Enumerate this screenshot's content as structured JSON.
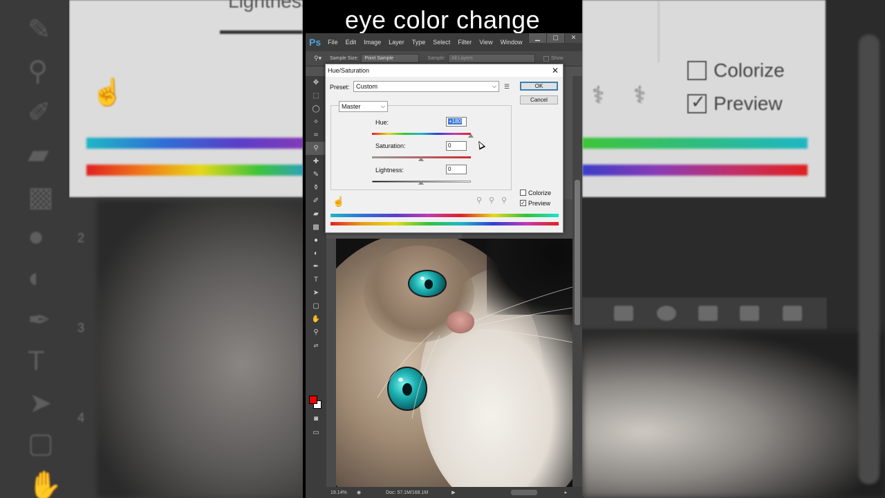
{
  "caption": "eye color change",
  "app": {
    "logo": "Ps",
    "menu": [
      "File",
      "Edit",
      "Image",
      "Layer",
      "Type",
      "Select",
      "Filter",
      "View",
      "Window"
    ],
    "window_controls": [
      "minimize-icon",
      "maximize-icon",
      "close-icon"
    ]
  },
  "options_bar": {
    "sample_size_label": "Sample Size:",
    "sample_size_value": "Point Sample",
    "sample_label": "Sample:",
    "sample_value": "All Layers",
    "show_label": "Show"
  },
  "status_bar": {
    "zoom": "19.14%",
    "doc": "Doc: 57.1M/168.1M"
  },
  "dialog": {
    "title": "Hue/Saturation",
    "preset_label": "Preset:",
    "preset_value": "Custom",
    "ok_label": "OK",
    "cancel_label": "Cancel",
    "channel_value": "Master",
    "hue_label": "Hue:",
    "hue_value": "+180",
    "saturation_label": "Saturation:",
    "saturation_value": "0",
    "lightness_label": "Lightness:",
    "lightness_value": "0",
    "colorize_label": "Colorize",
    "colorize_checked": false,
    "preview_label": "Preview",
    "preview_checked": true
  },
  "background": {
    "left_text_partial": "Lightness",
    "colorize_label": "Colorize",
    "preview_label": "Preview",
    "ruler_numbers": [
      "2",
      "3",
      "4"
    ]
  },
  "colors": {
    "accent": "#3a78d4",
    "foreground_swatch": "#e00000",
    "eye_color": "#1fb3b3"
  }
}
